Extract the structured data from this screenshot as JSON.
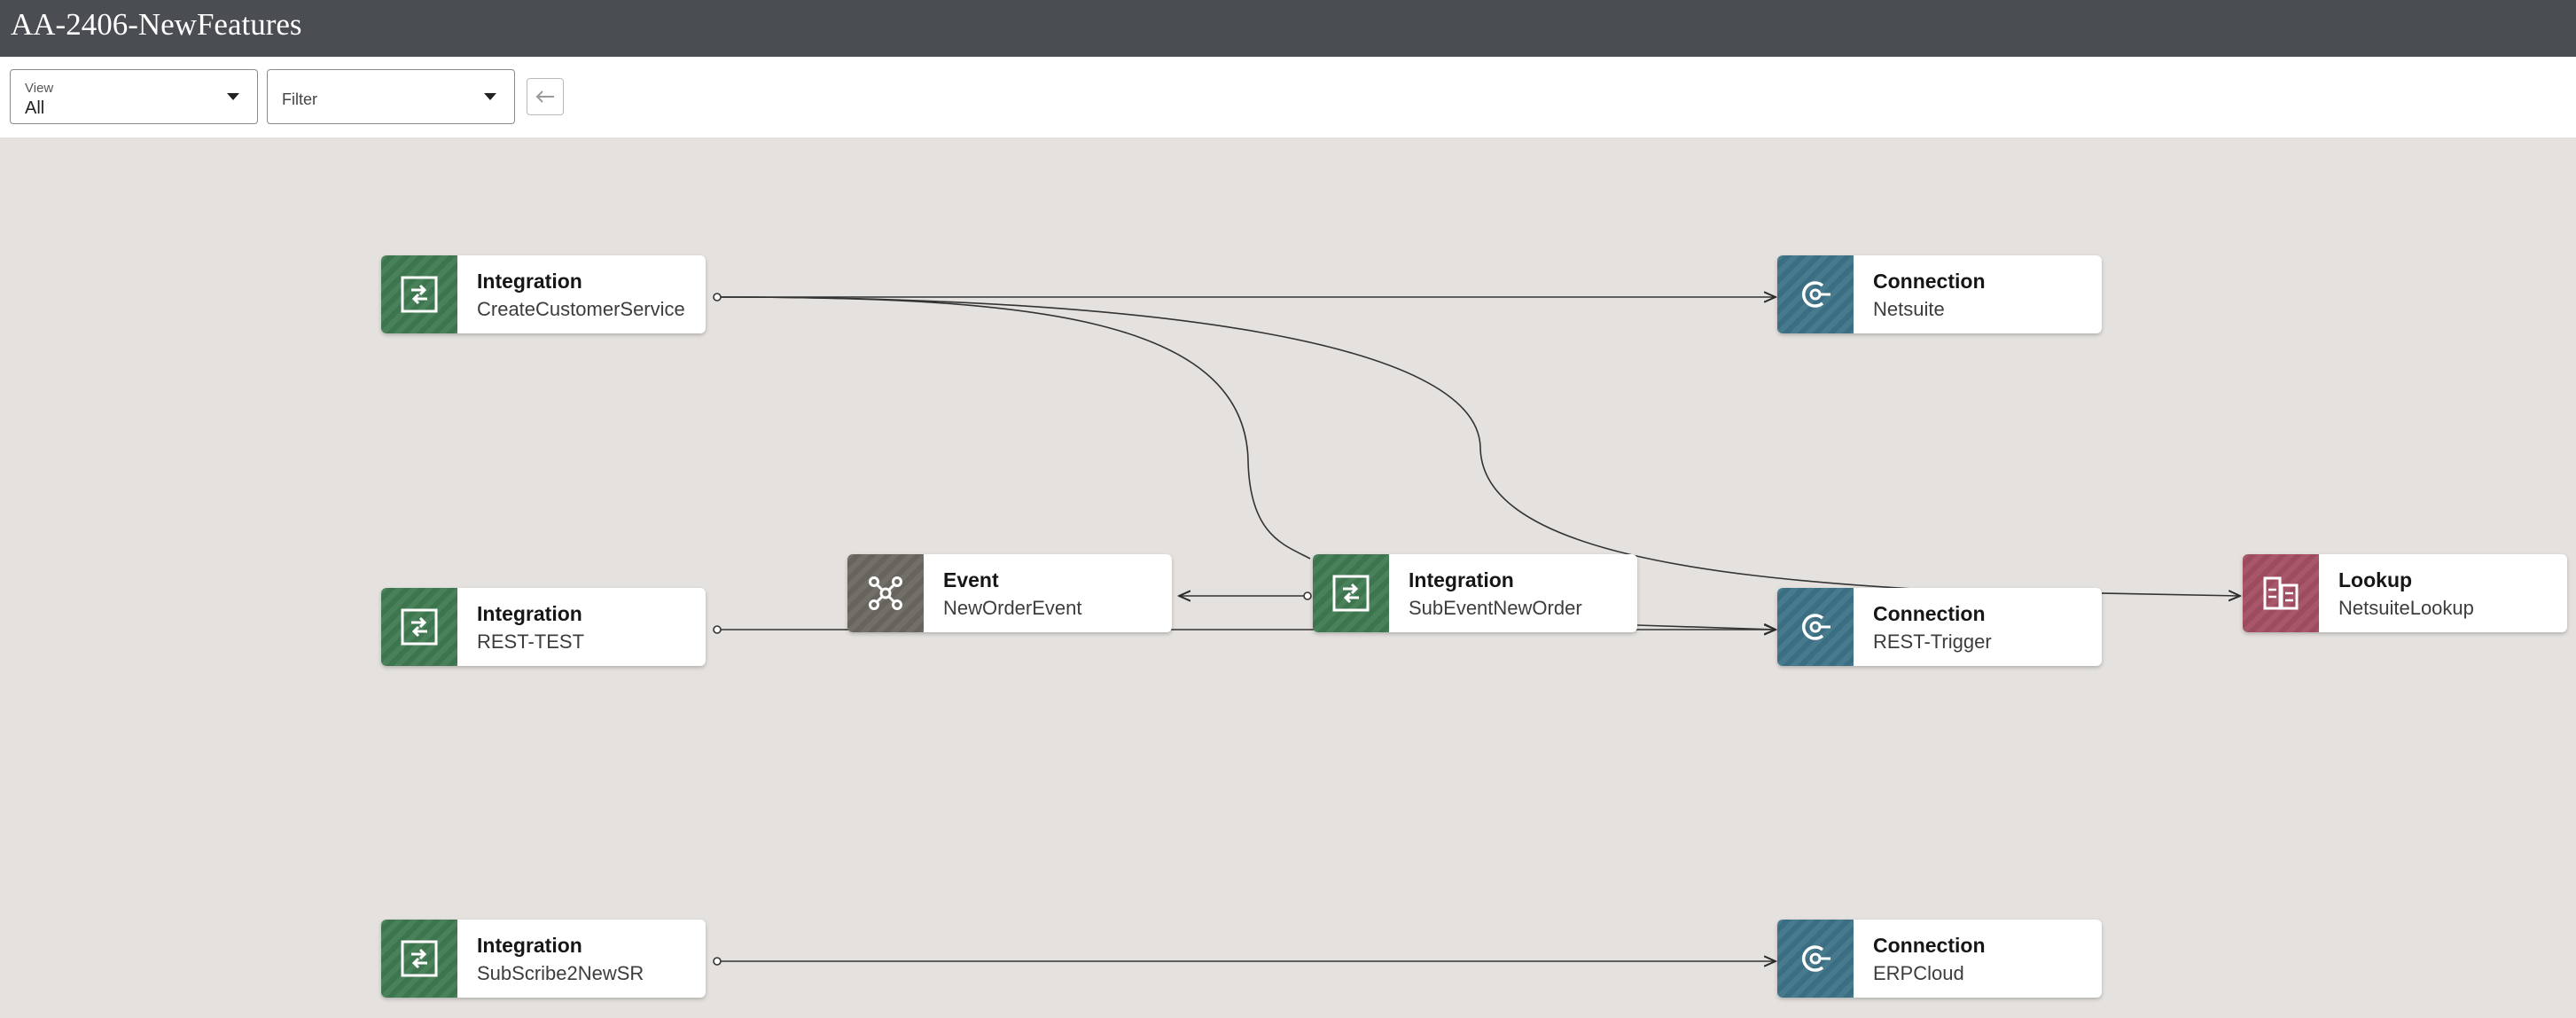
{
  "header": {
    "title": "AA-2406-NewFeatures"
  },
  "toolbar": {
    "view": {
      "label": "View",
      "value": "All"
    },
    "filter": {
      "placeholder": "Filter"
    }
  },
  "nodes": [
    {
      "type": "Integration",
      "name": "CreateCustomerService",
      "kind": "integration"
    },
    {
      "type": "Connection",
      "name": "Netsuite",
      "kind": "connection"
    },
    {
      "type": "Integration",
      "name": "REST-TEST",
      "kind": "integration"
    },
    {
      "type": "Event",
      "name": "NewOrderEvent",
      "kind": "event"
    },
    {
      "type": "Integration",
      "name": "SubEventNewOrder",
      "kind": "integration"
    },
    {
      "type": "Connection",
      "name": "REST-Trigger",
      "kind": "connection"
    },
    {
      "type": "Lookup",
      "name": "NetsuiteLookup",
      "kind": "lookup"
    },
    {
      "type": "Integration",
      "name": "SubScribe2NewSR",
      "kind": "integration"
    },
    {
      "type": "Connection",
      "name": "ERPCloud",
      "kind": "connection"
    }
  ],
  "colors": {
    "integration": "#3f7a52",
    "connection": "#3d7387",
    "event": "#6b6761",
    "lookup": "#a34e62",
    "canvas": "#e4e1de",
    "header": "#4a4d52"
  }
}
